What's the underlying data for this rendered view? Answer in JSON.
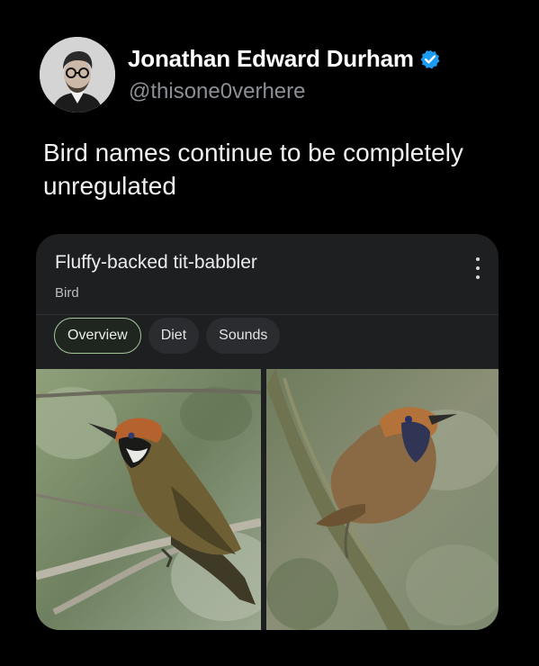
{
  "post": {
    "author": {
      "display_name": "Jonathan Edward Durham",
      "handle": "@thisone0verhere",
      "verified": true,
      "verified_icon": "verified-badge-icon",
      "verified_color": "#1d9bf0"
    },
    "text": "Bird names continue to be completely unregulated"
  },
  "knowledge_card": {
    "title": "Fluffy-backed tit-babbler",
    "subtitle": "Bird",
    "menu_icon": "more-vertical-icon",
    "tabs": [
      {
        "label": "Overview",
        "selected": true
      },
      {
        "label": "Diet",
        "selected": false
      },
      {
        "label": "Sounds",
        "selected": false
      }
    ],
    "accent_color": "#a7c79b",
    "images": [
      {
        "name": "bird-photo-left"
      },
      {
        "name": "bird-photo-right"
      }
    ]
  }
}
